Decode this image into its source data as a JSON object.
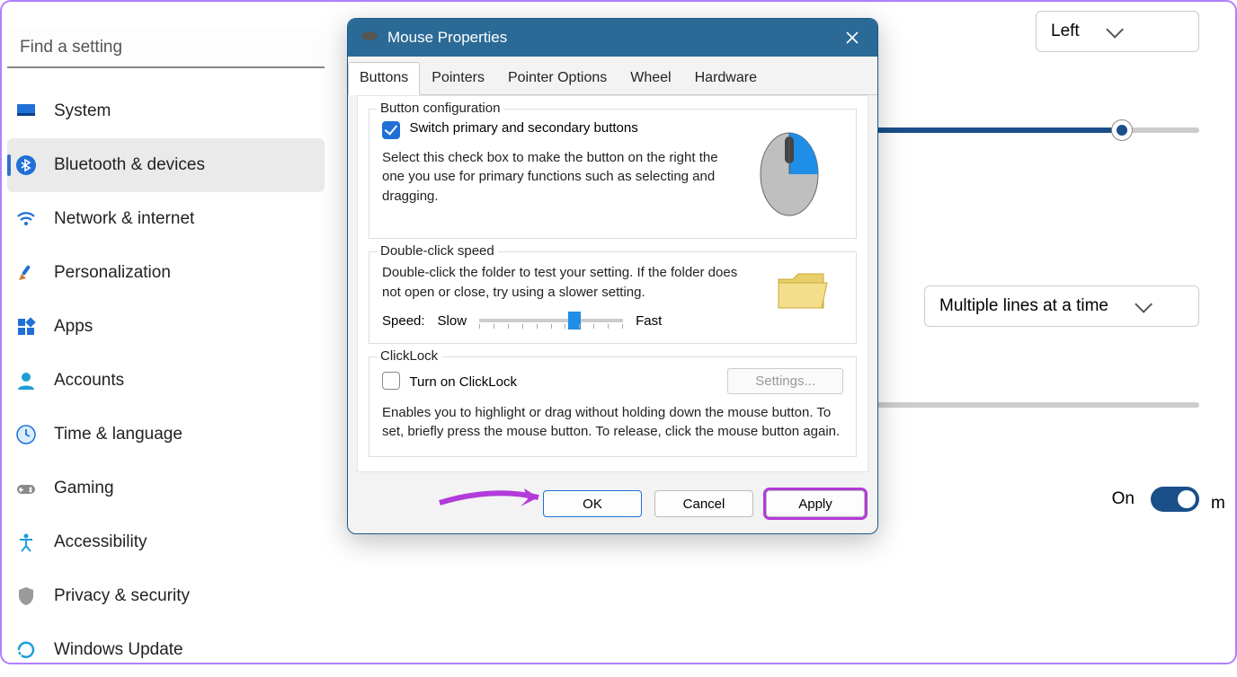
{
  "search": {
    "placeholder": "Find a setting"
  },
  "sidebar": {
    "items": [
      {
        "label": "System"
      },
      {
        "label": "Bluetooth & devices"
      },
      {
        "label": "Network & internet"
      },
      {
        "label": "Personalization"
      },
      {
        "label": "Apps"
      },
      {
        "label": "Accounts"
      },
      {
        "label": "Time & language"
      },
      {
        "label": "Gaming"
      },
      {
        "label": "Accessibility"
      },
      {
        "label": "Privacy & security"
      },
      {
        "label": "Windows Update"
      }
    ],
    "active_index": 1
  },
  "background_controls": {
    "primary_button_dropdown": "Left",
    "scroll_mode_dropdown": "Multiple lines at a time",
    "toggle_label": "On",
    "truncated_label": "m"
  },
  "dialog": {
    "title": "Mouse Properties",
    "tabs": [
      "Buttons",
      "Pointers",
      "Pointer Options",
      "Wheel",
      "Hardware"
    ],
    "active_tab": 0,
    "button_config": {
      "group_title": "Button configuration",
      "checkbox_label": "Switch primary and secondary buttons",
      "checked": true,
      "description": "Select this check box to make the button on the right the one you use for primary functions such as selecting and dragging."
    },
    "double_click": {
      "group_title": "Double-click speed",
      "description": "Double-click the folder to test your setting. If the folder does not open or close, try using a slower setting.",
      "speed_label": "Speed:",
      "slow_label": "Slow",
      "fast_label": "Fast"
    },
    "clicklock": {
      "group_title": "ClickLock",
      "checkbox_label": "Turn on ClickLock",
      "checked": false,
      "settings_button": "Settings...",
      "description": "Enables you to highlight or drag without holding down the mouse button. To set, briefly press the mouse button. To release, click the mouse button again."
    },
    "buttons": {
      "ok": "OK",
      "cancel": "Cancel",
      "apply": "Apply"
    }
  }
}
